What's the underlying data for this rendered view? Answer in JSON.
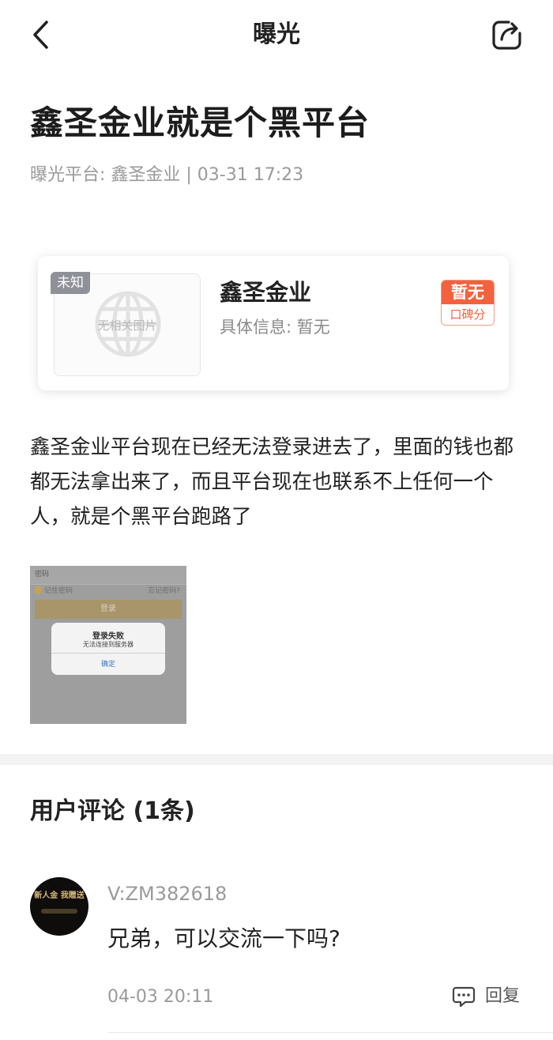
{
  "nav": {
    "title": "曝光",
    "back_icon": "chevron-left-icon",
    "share_icon": "share-icon"
  },
  "post": {
    "title": "鑫圣金业就是个黑平台",
    "meta": "曝光平台:  鑫圣金业 | 03-31 17:23",
    "body": "鑫圣金业平台现在已经无法登录进去了，里面的钱也都都无法拿出来了，而且平台现在也联系不上任何一个人，就是个黑平台跑路了"
  },
  "broker_card": {
    "tag": "未知",
    "no_image_text": "无相关图片",
    "name": "鑫圣金业",
    "info": "具体信息: 暂无",
    "score_value": "暂无",
    "score_label": "口碑分",
    "accent_color": "#f2623e"
  },
  "attachment": {
    "field_text": "密码",
    "remember_label": "记住密码",
    "forgot_label": "忘记密码?",
    "login_label": "登录",
    "dialog_title": "登录失败",
    "dialog_message": "无法连接到服务器",
    "dialog_confirm": "确定"
  },
  "comments": {
    "title": "用户评论 (1条)",
    "items": [
      {
        "avatar_text": "新人金 我赠送",
        "user": "V:ZM382618",
        "text": "兄弟，可以交流一下吗?",
        "time": "04-03 20:11",
        "reply_label": "回复",
        "reply_icon": "comment-icon"
      }
    ]
  }
}
